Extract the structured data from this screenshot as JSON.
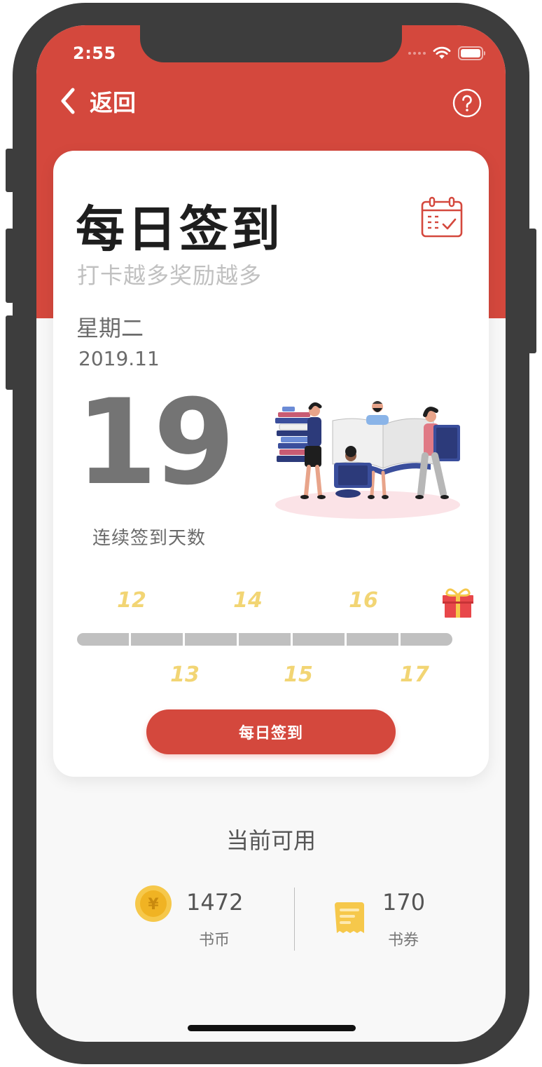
{
  "status_bar": {
    "time": "2:55"
  },
  "nav": {
    "back_label": "返回"
  },
  "card": {
    "title": "每日签到",
    "subtitle": "打卡越多奖励越多",
    "weekday": "星期二",
    "year_month": "2019.11",
    "day": "19",
    "streak_label": "连续签到天数",
    "progress_days_top": [
      "12",
      "14",
      "16"
    ],
    "progress_days_bottom": [
      "13",
      "15",
      "17"
    ],
    "progress_fraction": 0,
    "checkin_button": "每日签到"
  },
  "available": {
    "title": "当前可用",
    "coins": {
      "value": "1472",
      "label": "书币"
    },
    "vouchers": {
      "value": "170",
      "label": "书券"
    }
  },
  "colors": {
    "brand_red": "#d4483d",
    "day_yellow": "#f2d574",
    "track_gray": "#c0c0c0"
  },
  "icons": [
    "back-chevron-icon",
    "help-circle-icon",
    "calendar-check-icon",
    "gift-icon",
    "coin-icon",
    "voucher-icon",
    "wifi-icon",
    "battery-icon"
  ]
}
